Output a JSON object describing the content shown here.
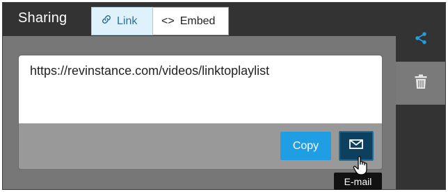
{
  "header": {
    "title": "Sharing"
  },
  "tabs": [
    {
      "label": "Link",
      "icon": "link-icon",
      "icon_glyph": "🔗",
      "active": true
    },
    {
      "label": "Embed",
      "icon": "code-icon",
      "icon_glyph": "<>",
      "active": false
    }
  ],
  "share": {
    "url": "https://revinstance.com/videos/linktoplaylist",
    "copy_label": "Copy",
    "email_icon": "mail-icon",
    "email_tooltip": "E-mail"
  },
  "sidebar": {
    "items": [
      {
        "icon": "share-icon",
        "active": true
      },
      {
        "icon": "trash-icon",
        "active": false
      }
    ]
  },
  "colors": {
    "accent": "#1f9ee3",
    "email_button": "#0d3f5f",
    "header_bg": "#333333",
    "body_bg": "#777777"
  }
}
